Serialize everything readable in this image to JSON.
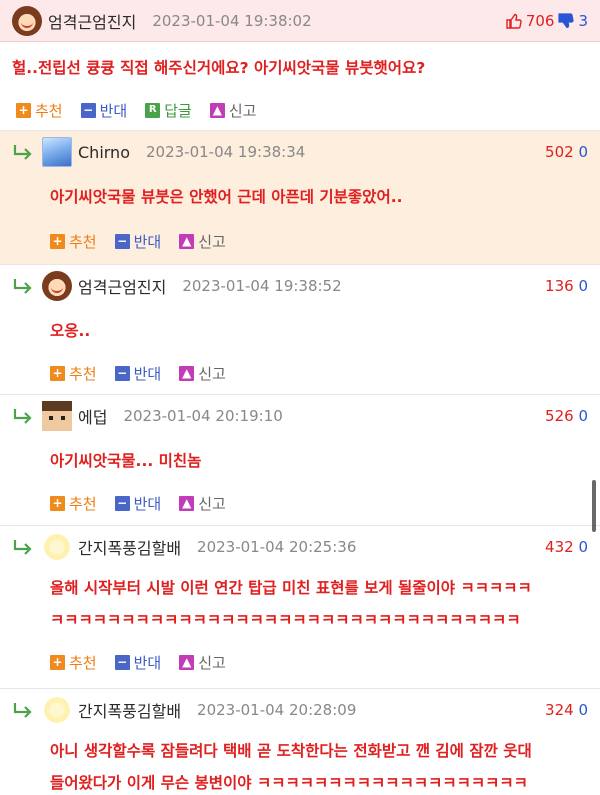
{
  "post": {
    "nickname": "엄격근엄진지",
    "date": "2023-01-04 19:38:02",
    "up_count": "706",
    "down_count": "3",
    "body": "헐..전립선 큥큥 직접 해주신거에요? 아기씨앗국물 뷰붓햇어요?",
    "actions": {
      "recommend": "추천",
      "oppose": "반대",
      "reply": "답글",
      "report": "신고"
    }
  },
  "comments": [
    {
      "nickname": "Chirno",
      "date": "2023-01-04 19:38:34",
      "up": "502",
      "down": "0",
      "lines": [
        "아기씨앗국물 뷰붓은 안했어 근데 아픈데 기분좋았어.."
      ],
      "avatar": "blue-character-avatar"
    },
    {
      "nickname": "엄격근엄진지",
      "date": "2023-01-04 19:38:52",
      "up": "136",
      "down": "0",
      "lines": [
        "오옹.."
      ],
      "avatar": "girl-avatar"
    },
    {
      "nickname": "에덥",
      "date": "2023-01-04 20:19:10",
      "up": "526",
      "down": "0",
      "lines": [
        "아기씨앗국물... 미친놈"
      ],
      "avatar": "pixel-avatar"
    },
    {
      "nickname": "간지폭풍김할배",
      "date": "2023-01-04 20:25:36",
      "up": "432",
      "down": "0",
      "lines": [
        "올해 시작부터 시발 이런 연간 탑급 미친 표현를 보게 될줄이야 ㅋㅋㅋㅋㅋ",
        "ㅋㅋㅋㅋㅋㅋㅋㅋㅋㅋㅋㅋㅋㅋㅋㅋㅋㅋㅋㅋㅋㅋㅋㅋㅋㅋㅋㅋㅋㅋㅋㅋㅋ"
      ],
      "avatar": "sun-avatar"
    },
    {
      "nickname": "간지폭풍김할배",
      "date": "2023-01-04 20:28:09",
      "up": "324",
      "down": "0",
      "lines": [
        "아니 생각할수록 잠들려다 택배 곧 도착한다는 전화받고 깬 김에 잠깐 웃대",
        "들어왔다가 이게 무슨 봉변이야 ㅋㅋㅋㅋㅋㅋㅋㅋㅋㅋㅋㅋㅋㅋㅋㅋㅋㅋㅋ"
      ],
      "avatar": "sun-avatar"
    }
  ],
  "comment_actions": {
    "recommend": "추천",
    "oppose": "반대",
    "report": "신고"
  },
  "colors": {
    "header_bg": "#fde9ea",
    "highlight_bg": "#fdeedd",
    "text_red": "#e02020",
    "up_red": "#e02020",
    "down_blue": "#2a56d6"
  }
}
